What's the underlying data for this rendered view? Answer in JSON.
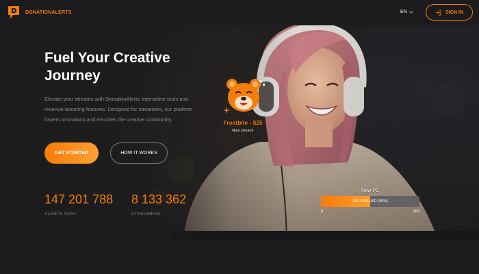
{
  "header": {
    "brand": "DONATIONALERTS",
    "language": "EN",
    "sign_in_label": "SIGN IN"
  },
  "hero": {
    "title_line1": "Fuel Your Creative",
    "title_line2": "Journey",
    "description": "Elevate your streams with DonationAlerts' interactive tools and revenue-boosting features. Designed for streamers, our platform fosters innovation and enriches the creative community.",
    "primary_button": "GET STARTED",
    "secondary_button": "HOW IT WORKS"
  },
  "stats": [
    {
      "value": "147 201 788",
      "label": "ALERTS SENT"
    },
    {
      "value": "8 133 362",
      "label": "STREAMERS"
    }
  ],
  "alert": {
    "title": "Frostbite - $25",
    "message": "Nice stream!"
  },
  "goal": {
    "title": "New PC",
    "progress_text": "250 / 500 USD (50%)",
    "progress_fraction": 0.5,
    "min_label": "0",
    "max_label": "500"
  },
  "icons": {
    "logo": "donationalerts-logo-icon",
    "language_dropdown": "chevron-down-icon",
    "sign_in": "sign-in-icon",
    "mascot": "bear-mascot-icon",
    "sparkle": "sparkle-icon"
  },
  "colors": {
    "accent": "#f57d07",
    "background": "#1b1b1d",
    "muted_text": "#8b8b90",
    "white": "#ffffff"
  }
}
